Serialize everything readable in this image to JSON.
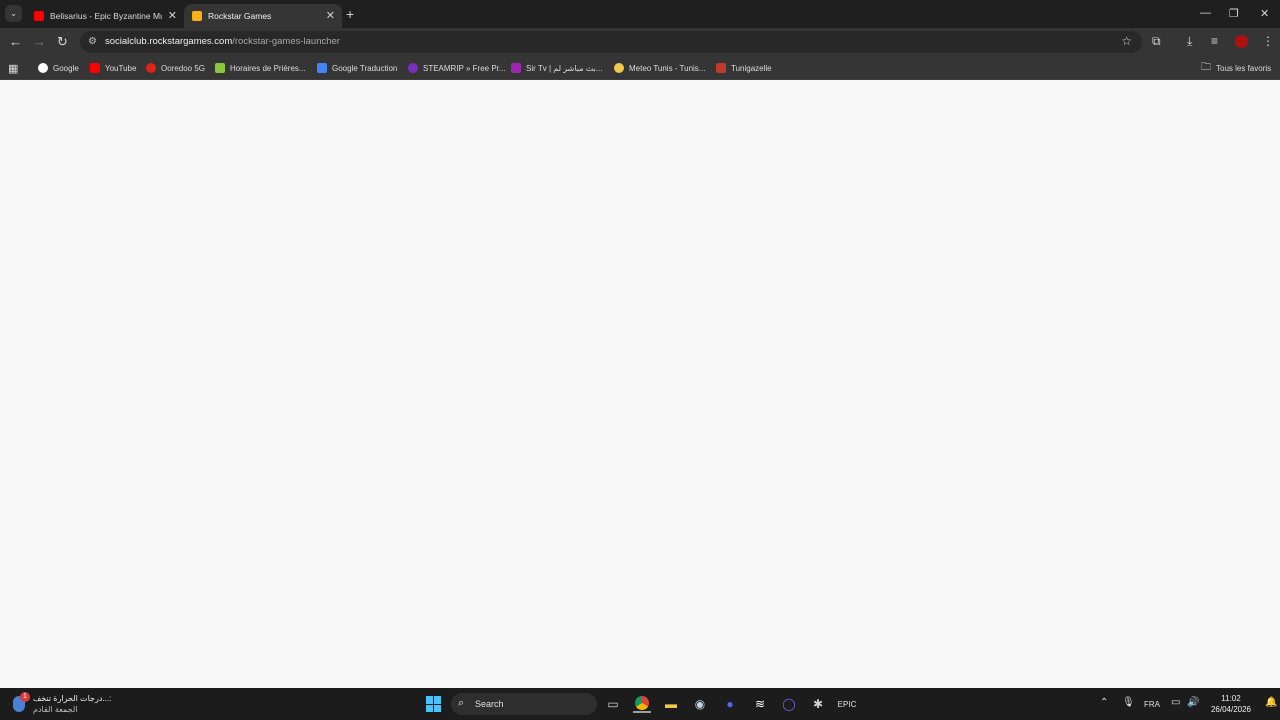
{
  "browser": {
    "tabs": [
      {
        "title": "Belisarius - Epic Byzantine Musi",
        "favicon": "youtube-icon",
        "active": false
      },
      {
        "title": "Rockstar Games",
        "favicon": "rockstar-icon",
        "active": true
      }
    ],
    "new_tab_label": "+",
    "address_bar": {
      "host": "socialclub.rockstargames.com",
      "path": "/rockstar-games-launcher"
    },
    "bookmarks": [
      {
        "label": "Google",
        "icon": "google-icon",
        "color": "#ffffff"
      },
      {
        "label": "YouTube",
        "icon": "youtube-icon",
        "color": "#ff0000"
      },
      {
        "label": "Ooredoo 5G",
        "icon": "ooredoo-icon",
        "color": "#e2231a"
      },
      {
        "label": "Horaires de Prières...",
        "icon": "prayer-times-icon",
        "color": "#8dc63f"
      },
      {
        "label": "Google Traduction",
        "icon": "translate-icon",
        "color": "#4285f4"
      },
      {
        "label": "STEAMRIP » Free Pr...",
        "icon": "steamrip-icon",
        "color": "#7b2fbe"
      },
      {
        "label": "Sir Tv | بث مباشر لم...",
        "icon": "sirtv-icon",
        "color": "#9b27af"
      },
      {
        "label": "Meteo Tunis - Tunis...",
        "icon": "weather-icon",
        "color": "#f2c94c"
      },
      {
        "label": "Tunigazelle",
        "icon": "tunigazelle-icon",
        "color": "#c0392b"
      }
    ],
    "all_bookmarks_label": "Tous les favoris"
  },
  "taskbar": {
    "weather": {
      "line1": "درجات الحرارة تنخف...:",
      "line2": "الجمعة القادم",
      "badge": "1"
    },
    "search_label": "Search",
    "language": "FRA",
    "time": "11:02",
    "date": "26/04/2026"
  }
}
